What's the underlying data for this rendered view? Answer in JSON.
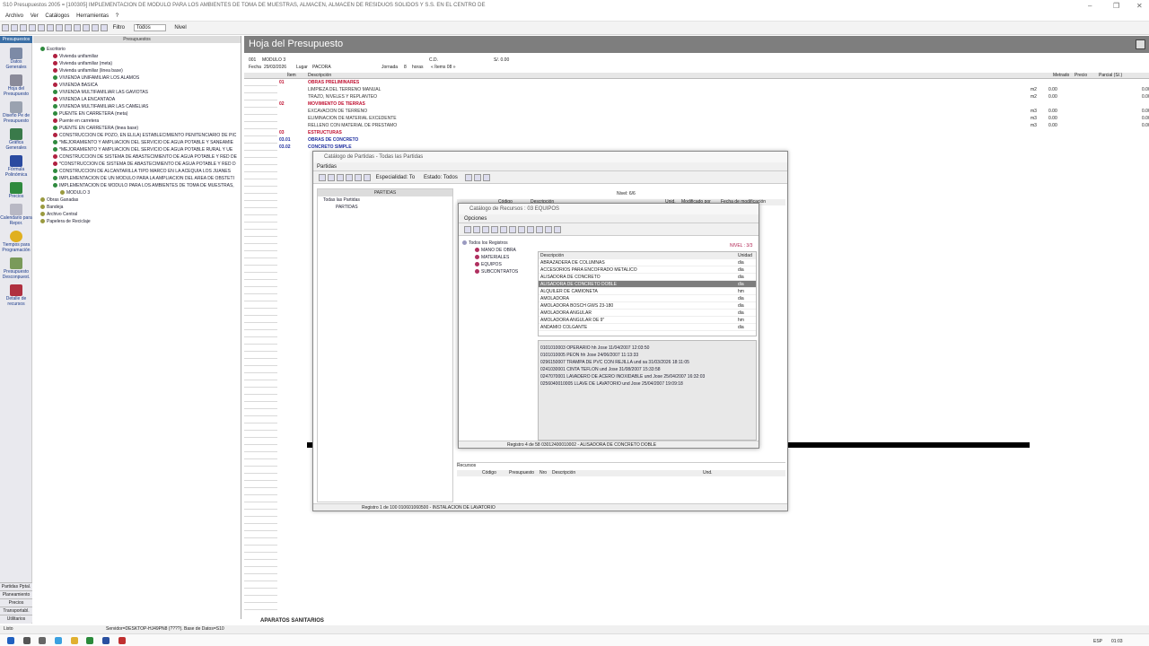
{
  "app": {
    "title": "S10 Presupuestos 2005 = [100305] IMPLEMENTACION DE MODULO PARA LOS AMBIENTES DE TOMA DE MUESTRAS, ALMACEN, ALMACEN DE RESIDUOS SOLIDOS Y S.S. EN EL CENTRO DE"
  },
  "menu": [
    "Archivo",
    "Ver",
    "Catálogos",
    "Herramientas",
    "?"
  ],
  "toolbar": {
    "filter_label": "Filtro",
    "filter_value": "Todos",
    "level_label": "Nivel"
  },
  "nav": {
    "header": "Presupuestos",
    "items": [
      "Datos Generales",
      "Hoja del Presupuesto",
      "Diseño Pe de Presupuesto",
      "Gráfica Generales",
      "Fórmula Polinómica",
      "Precios",
      "Calendario para Repor.",
      "Tiempos para Programación",
      "Presupuesto Desconpuest.",
      "Detalle de recursos"
    ],
    "bottom": [
      "Partidas Pptal.",
      "Planeamiento",
      "Precios",
      "Transportabl.",
      "Utilitarios"
    ]
  },
  "tree": {
    "header": "Presupuestos",
    "items": [
      "Escritorio",
      "Vivienda unifamiliar",
      "Vivienda unifamiliar (meta)",
      "Vivienda unifamiliar (linea base)",
      "VIVIENDA UNIFAMILIAR LOS ALAMOS",
      "VIVIENDA BASICA",
      "VIVIENDA MULTIFAMILIAR LAS GAVIOTAS",
      "VIVIENDA LA ENCANTADA",
      "VIVIENDA MULTIFAMILIAR LAS CAMELIAS",
      "PUENTE EN CARRETERA (meta)",
      "Puente en carretera",
      "PUENTE EN CARRETERA (linea base)",
      "CONSTRUCCION DE POZO, EN ELILA) ESTABLECIMIENTO PENITENCIARIO DE PIC",
      "*MEJORAMIENTO Y AMPLIACION DEL SERVICIO DE AGUA POTABLE Y SANEAMIE",
      "*MEJORAMIENTO Y AMPLIACION DEL SERVICIO DE AGUA POTABLE RURAL Y UE",
      "CONSTRUCCION DE SISTEMA DE ABASTECIMIENTO DE AGUA POTABLE Y RED DE",
      "*CONSTRUCCION DE SISTEMA DE ABASTECIMIENTO DE AGUA POTABLE Y RED D",
      "CONSTRUCCION DE ALCANTARILLA TIPO MARCO EN LA ACEQUIA LOS JUANES",
      "IMPLEMENTACION DE UN MODULO PARA LA AMPLIACION DEL AREA DE OBSTETI",
      "IMPLEMENTACION DE MODULO PARA LOS AMBIENTES DE TOMA DE MUESTRAS,",
      "MODULO 3",
      "Obras Ganadas",
      "Bandeja",
      "Archivo Central",
      "Papelera de Reciclaje"
    ]
  },
  "sheet": {
    "title": "Hoja del Presupuesto",
    "code": "001",
    "module": "MODULO 3",
    "cd_label": "C.D.",
    "cd_value": "S/. 0.00",
    "fecha_label": "Fecha",
    "fecha": "29/03/2026",
    "lugar_label": "Lugar",
    "lugar": "PACORA",
    "jornada_label": "Jornada",
    "jornada": "8",
    "horas": "horas",
    "items_label": "« Ítems 08 »",
    "cols": [
      "Ítem",
      "Descripción",
      "Metrado",
      "Precio",
      "Parcial (S/.)"
    ],
    "rows": [
      {
        "c": "01",
        "d": "OBRAS PRELIMINARES",
        "h": 1
      },
      {
        "c": "",
        "d": "LIMPIEZA DEL TERRENO MANUAL",
        "u": "m2",
        "m": "0.00",
        "p": "0.00"
      },
      {
        "c": "",
        "d": "TRAZO, NIVELES Y REPLANTEO",
        "u": "m2",
        "m": "0.00",
        "p": "0.00"
      },
      {
        "c": "02",
        "d": "MOVIMIENTO DE TIERRAS",
        "h": 1
      },
      {
        "c": "",
        "d": "EXCAVACION DE TERRENO",
        "u": "m3",
        "m": "0.00",
        "p": "0.00"
      },
      {
        "c": "",
        "d": "ELIMINACION DE MATERIAL EXCEDENTE",
        "u": "m3",
        "m": "0.00",
        "p": "0.00"
      },
      {
        "c": "",
        "d": "RELLENO CON MATERIAL DE PRESTAMO",
        "u": "m3",
        "m": "0.00",
        "p": "0.00"
      },
      {
        "c": "03",
        "d": "ESTRUCTURAS",
        "h": 1
      },
      {
        "c": "03.01",
        "d": "OBRAS DE CONCRETO",
        "h": 2
      },
      {
        "c": "03.02",
        "d": "CONCRETO SIMPLE",
        "h": 2
      }
    ]
  },
  "cat_partidas": {
    "title": "Catálogo de Partidas - Todas las Partidas",
    "menu": "Partidas",
    "especialidad": "Especialidad: To",
    "estado": "Estado: Todos",
    "nivel": "Nivel: 6/6",
    "tree_header": "PARTIDAS",
    "tree": [
      "Todas las Partidas",
      "PARTIDAS"
    ],
    "cols": [
      "Código",
      "Descripción",
      "Unid.",
      "Modificado por",
      "Fecha de modificación"
    ],
    "status": "Registro 1 de 100  010601060500 - INSTALACION DE LAVATORIO",
    "recursos_label": "Recursos",
    "rec_cols": [
      "Código",
      "Presupuesto",
      "Nro",
      "Descripción",
      "Und."
    ]
  },
  "cat_recursos": {
    "title": "Catálogo de Recursos : 03 EQUIPOS",
    "menu": "Opciones",
    "nivel": "NIVEL : 3/3",
    "tree": [
      "Todos los Registros",
      "MANO DE OBRA",
      "MATERIALES",
      "EQUIPOS",
      "SUBCONTRATOS"
    ],
    "col_desc": "Descripción",
    "col_unit": "Unidad",
    "rows": [
      [
        "ABRAZADERA DE COLUMNAS",
        "dia"
      ],
      [
        "ACCESORIOS PARA ENCOFRADO METALICO",
        "dia"
      ],
      [
        "ALISADORA DE CONCRETO",
        "dia"
      ],
      [
        "ALISADORA DE CONCRETO DOBLE",
        "dia"
      ],
      [
        "ALQUILER DE CAMIONETA",
        "hm"
      ],
      [
        "AMOLADORA",
        "dia"
      ],
      [
        "AMOLADORA BOSCH GWS 23-180",
        "dia"
      ],
      [
        "AMOLADORA ANGULAR",
        "dia"
      ],
      [
        "AMOLADORA ANGULAR DE 9\"",
        "hm"
      ],
      [
        "ANDAMIO COLGANTE",
        "dia"
      ]
    ],
    "detail": [
      "0101010003   OPERARIO   hh   Jose  11/04/2007 12:03:50",
      "0101010005   PEON   hh   Jose  24/06/2007 11:13:33",
      "0296150007   TRAMPA DE PVC CON REJILLA  und   sa  31/03/2026 18:11:05",
      "0241030001   CINTA TEFLON   und   Jose  31/08/2007 15:33:58",
      "0247070001   LAVADERO DE ACERO INOXIDABLE   und   Jose  25/04/2007 16:32:03",
      "0256040010005   LLAVE DE LAVATORIO   und   Jose  25/04/2007 19:09:18"
    ],
    "status": "Registro  4  de  58     03012400010002 - ALISADORA DE CONCRETO DOBLE"
  },
  "status": {
    "left": "Listo",
    "server": "Servidor=DESKTOP-HJ49PN8 (????). Base de Datos=S10",
    "bottom_item": "APARATOS SANITARIOS"
  },
  "taskbar": {
    "lang": "ESP",
    "time": "01:03"
  }
}
